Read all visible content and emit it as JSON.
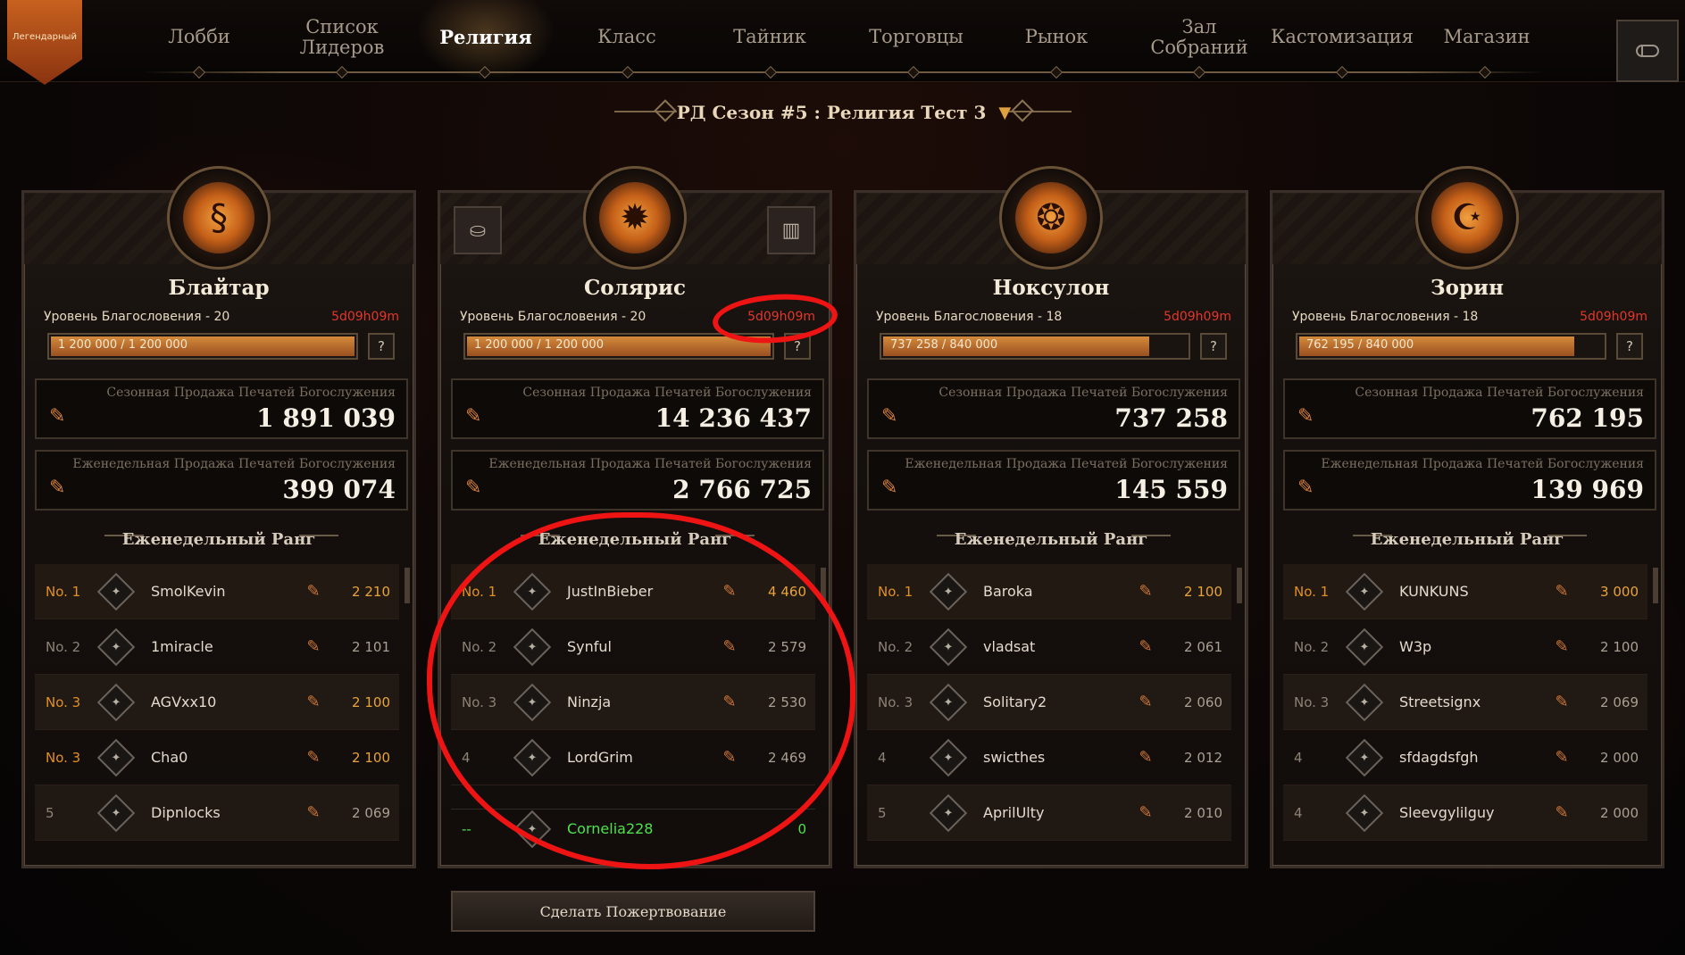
{
  "nav": {
    "items": [
      "Лобби",
      "Список Лидеров",
      "Религия",
      "Класс",
      "Тайник",
      "Торговцы",
      "Рынок",
      "Зал Собраний",
      "Кастомизация",
      "Магазин"
    ],
    "active": "Религия",
    "rank_badge": "Легендарный"
  },
  "season": {
    "label": "РД Сезон #5 : Религия Тест 3"
  },
  "labels": {
    "bless_level": "Уровень Благословения",
    "season_sale": "Сезонная Продажа Печатей Богослужения",
    "weekly_sale": "Еженедельная Продажа Печатей Богослужения",
    "weekly_rank": "Еженедельный Ранг",
    "help": "?",
    "donate": "Сделать Пожертвование"
  },
  "religions": [
    {
      "name": "Блайтар",
      "level": "Уровень Благословения - 20",
      "timer": "5d09h09m",
      "progress_text": "1 200 000 / 1 200 000",
      "progress": 1.0,
      "season_total": "1 891 039",
      "weekly_total": "399 074",
      "icon": "serpent-icon",
      "ranking": [
        {
          "rank": "No. 1",
          "name": "SmolKevin",
          "score": "2 210",
          "gold": true
        },
        {
          "rank": "No. 2",
          "name": "1miracle",
          "score": "2 101",
          "gold": false
        },
        {
          "rank": "No. 3",
          "name": "AGVxx10",
          "score": "2 100",
          "gold": true
        },
        {
          "rank": "No. 3",
          "name": "Cha0",
          "score": "2 100",
          "gold": true
        },
        {
          "rank": "5",
          "name": "Dipnlocks",
          "score": "2 069",
          "gold": false
        }
      ]
    },
    {
      "name": "Солярис",
      "level": "Уровень Благословения - 20",
      "timer": "5d09h09m",
      "progress_text": "1 200 000 / 1 200 000",
      "progress": 1.0,
      "season_total": "14 236 437",
      "weekly_total": "2 766 725",
      "icon": "sun-icon",
      "ranking": [
        {
          "rank": "No. 1",
          "name": "JustInBieber",
          "score": "4 460",
          "gold": true
        },
        {
          "rank": "No. 2",
          "name": "Synful",
          "score": "2 579",
          "gold": false
        },
        {
          "rank": "No. 3",
          "name": "Ninzja",
          "score": "2 530",
          "gold": false
        },
        {
          "rank": "4",
          "name": "LordGrim",
          "score": "2 469",
          "gold": false
        }
      ],
      "self": {
        "rank": "--",
        "name": "Cornelia228",
        "score": "0"
      }
    },
    {
      "name": "Ноксулон",
      "level": "Уровень Благословения - 18",
      "timer": "5d09h09m",
      "progress_text": "737 258 / 840 000",
      "progress": 0.878,
      "season_total": "737 258",
      "weekly_total": "145 559",
      "icon": "winged-sun-icon",
      "ranking": [
        {
          "rank": "No. 1",
          "name": "Baroka",
          "score": "2 100",
          "gold": true
        },
        {
          "rank": "No. 2",
          "name": "vladsat",
          "score": "2 061",
          "gold": false
        },
        {
          "rank": "No. 3",
          "name": "Solitary2",
          "score": "2 060",
          "gold": false
        },
        {
          "rank": "4",
          "name": "swicthes",
          "score": "2 012",
          "gold": false
        },
        {
          "rank": "5",
          "name": "AprilUlty",
          "score": "2 010",
          "gold": false
        }
      ]
    },
    {
      "name": "Зорин",
      "level": "Уровень Благословения - 18",
      "timer": "5d09h09m",
      "progress_text": "762 195 / 840 000",
      "progress": 0.907,
      "season_total": "762 195",
      "weekly_total": "139 969",
      "icon": "moon-star-icon",
      "ranking": [
        {
          "rank": "No. 1",
          "name": "KUNKUNS",
          "score": "3 000",
          "gold": true
        },
        {
          "rank": "No. 2",
          "name": "W3p",
          "score": "2 100",
          "gold": false
        },
        {
          "rank": "No. 3",
          "name": "Streetsignx",
          "score": "2 069",
          "gold": false
        },
        {
          "rank": "4",
          "name": "sfdagdsfgh",
          "score": "2 000",
          "gold": false
        },
        {
          "rank": "4",
          "name": "Sleevgylilguy",
          "score": "2 000",
          "gold": false
        }
      ]
    }
  ]
}
